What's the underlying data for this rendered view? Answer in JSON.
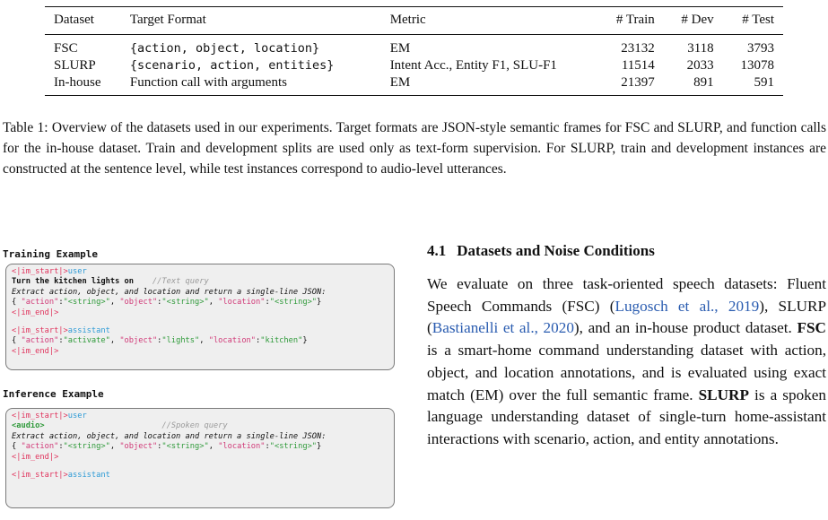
{
  "table": {
    "headers": [
      "Dataset",
      "Target Format",
      "Metric",
      "# Train",
      "# Dev",
      "# Test"
    ],
    "rows": [
      {
        "dataset": "FSC",
        "format": "{action, object, location}",
        "metric": "EM",
        "train": "23132",
        "dev": "3118",
        "test": "3793"
      },
      {
        "dataset": "SLURP",
        "format": "{scenario, action, entities}",
        "metric": "Intent Acc., Entity F1, SLU-F1",
        "train": "11514",
        "dev": "2033",
        "test": "13078"
      },
      {
        "dataset": "In-house",
        "format": "Function call with arguments",
        "metric": "EM",
        "train": "21397",
        "dev": "891",
        "test": "591"
      }
    ]
  },
  "caption": "Table 1: Overview of the datasets used in our experiments. Target formats are JSON-style semantic frames for FSC and SLURP, and function calls for the in-house dataset. Train and development splits are used only as text-form supervision. For SLURP, train and development instances are constructed at the sentence level, while test instances correspond to audio-level utterances.",
  "training": {
    "title": "Training Example",
    "im_start": "<|im_start|>",
    "im_end": "<|im_end|>",
    "user": "user",
    "assistant": "assistant",
    "query": "Turn the kitchen lights on",
    "query_comment": "//Text query",
    "instruction": "Extract action, object, and location and return a single-line JSON:",
    "schema": {
      "open": "{ ",
      "k1": "\"action\"",
      "v1": "\"<string>\"",
      "k2": "\"object\"",
      "v2": "\"<string>\"",
      "k3": "\"location\"",
      "v3": "\"<string>\"",
      "close": "}"
    },
    "answer": {
      "open": "{ ",
      "k1": "\"action\"",
      "v1": "\"activate\"",
      "k2": "\"object\"",
      "v2": "\"lights\"",
      "k3": "\"location\"",
      "v3": "\"kitchen\"",
      "close": "}"
    }
  },
  "inference": {
    "title": "Inference Example",
    "im_start": "<|im_start|>",
    "im_end": "<|im_end|>",
    "user": "user",
    "assistant": "assistant",
    "audio": "<audio>",
    "audio_comment": "//Spoken query",
    "instruction": "Extract action, object, and location and return a single-line JSON:",
    "schema": {
      "open": "{ ",
      "k1": "\"action\"",
      "v1": "\"<string>\"",
      "k2": "\"object\"",
      "v2": "\"<string>\"",
      "k3": "\"location\"",
      "v3": "\"<string>\"",
      "close": "}"
    }
  },
  "section": {
    "number": "4.1",
    "title": "Datasets and Noise Conditions",
    "p1": "We evaluate on three task-oriented speech datasets: Fluent Speech Commands (FSC) (",
    "cite1": "Lugosch et al., 2019",
    "p2": "), SLURP (",
    "cite2": "Bastianelli et al., 2020",
    "p3": "), and an in-house product dataset. ",
    "fsc_bold": "FSC",
    "p4": " is a smart-home command understanding dataset with action, object, and location annotations, and is evaluated using exact match (EM) over the full semantic frame. ",
    "slurp_bold": "SLURP",
    "p5": " is a spoken language understanding dataset of single-turn home-assistant interactions with scenario, action, and entity annotations."
  }
}
